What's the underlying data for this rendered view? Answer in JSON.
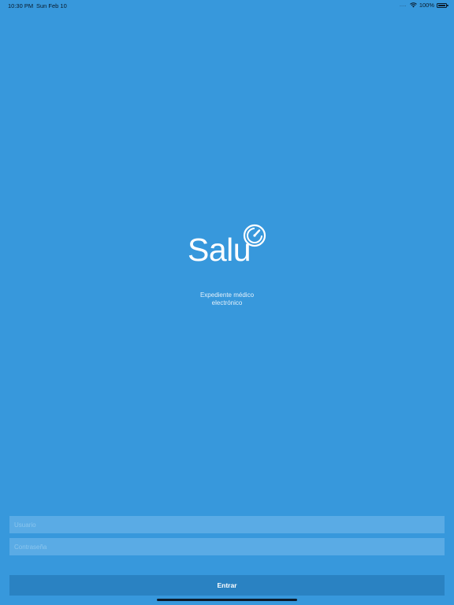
{
  "status_bar": {
    "time": "10:30 PM",
    "date": "Sun Feb 10",
    "signal_dots": "....",
    "wifi_icon": "wifi-icon",
    "battery_percent": "100%",
    "battery_level": 1.0
  },
  "brand": {
    "name": "Salu",
    "logo_icon": "gauge-circle-icon",
    "tagline_line1": "Expediente médico",
    "tagline_line2": "electrónico"
  },
  "login": {
    "username_placeholder": "Usuario",
    "username_value": "",
    "password_placeholder": "Contraseña",
    "password_value": "",
    "submit_label": "Entrar"
  },
  "colors": {
    "background": "#3798dc",
    "field_background": "#5aabe5",
    "button_background": "#2a82c2",
    "text": "#ffffff"
  }
}
